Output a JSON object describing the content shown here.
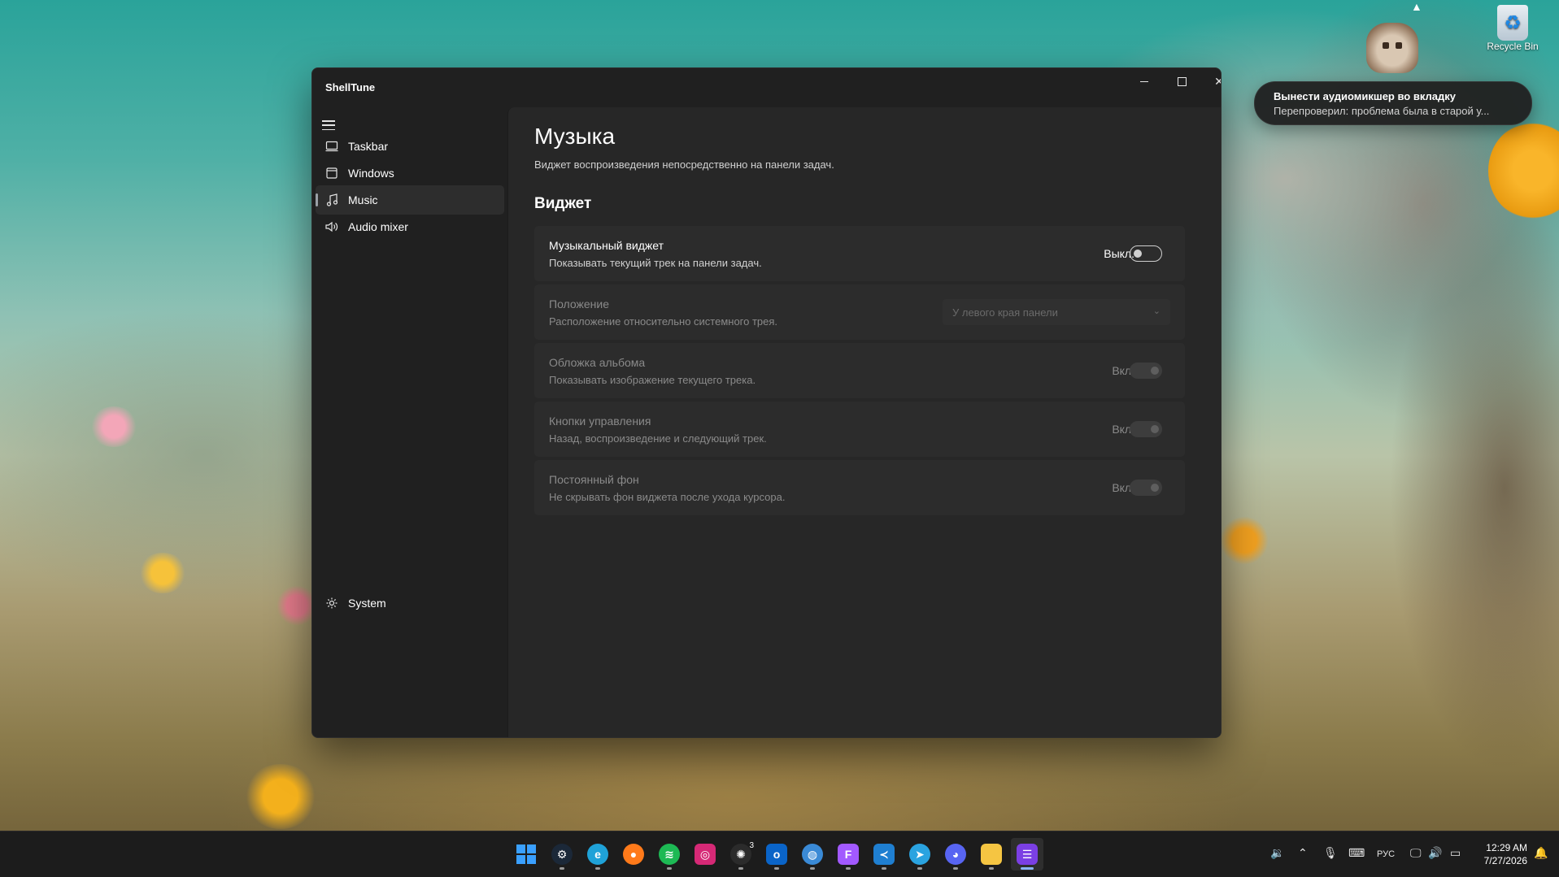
{
  "desktop": {
    "recycle_bin_label": "Recycle Bin"
  },
  "notification": {
    "title": "Вынести аудиомикшер во вкладку",
    "body": "Перепроверил: проблема была в старой у..."
  },
  "window": {
    "title": "ShellTune",
    "controls": {
      "minimize": "minimize-icon",
      "maximize": "maximize-icon",
      "close": "close-icon"
    }
  },
  "sidebar": {
    "items": [
      {
        "label": "Taskbar",
        "icon": "taskbar-icon",
        "active": false
      },
      {
        "label": "Windows",
        "icon": "window-icon",
        "active": false
      },
      {
        "label": "Music",
        "icon": "music-note-icon",
        "active": true
      },
      {
        "label": "Audio mixer",
        "icon": "speaker-icon",
        "active": false
      }
    ],
    "footer": {
      "label": "System",
      "icon": "gear-icon"
    }
  },
  "page": {
    "title": "Музыка",
    "subtitle": "Виджет воспроизведения непосредственно на панели задач.",
    "section": "Виджет"
  },
  "settings": [
    {
      "title": "Музыкальный виджет",
      "desc": "Показывать текущий трек на панели задач.",
      "state_label": "Выкл.",
      "enabled": true,
      "on": false
    },
    {
      "title": "Положение",
      "desc": "Расположение относительно системного трея.",
      "dropdown_value": "У левого края панели",
      "enabled": false
    },
    {
      "title": "Обложка альбома",
      "desc": "Показывать изображение текущего трека.",
      "state_label": "Вкл.",
      "enabled": false,
      "on": true
    },
    {
      "title": "Кнопки управления",
      "desc": "Назад, воспроизведение и следующий трек.",
      "state_label": "Вкл.",
      "enabled": false,
      "on": true
    },
    {
      "title": "Постоянный фон",
      "desc": "Не скрывать фон виджета после ухода курсора.",
      "state_label": "Вкл.",
      "enabled": false,
      "on": true
    }
  ],
  "taskbar": {
    "apps": [
      {
        "name": "start",
        "icon": "windows-logo-icon",
        "color": "#3aa0ff"
      },
      {
        "name": "steam",
        "icon": "steam-icon",
        "color": "#1b2838"
      },
      {
        "name": "edge",
        "icon": "edge-icon",
        "color": "#1fa2d8"
      },
      {
        "name": "firefox",
        "icon": "firefox-icon",
        "color": "#ff7a1a"
      },
      {
        "name": "spotify",
        "icon": "spotify-icon",
        "color": "#1db954"
      },
      {
        "name": "instagram",
        "icon": "instagram-icon",
        "color": "#d62976"
      },
      {
        "name": "chatgpt",
        "icon": "chatgpt-icon",
        "color": "#2b2b2b",
        "badge": "3"
      },
      {
        "name": "outlook",
        "icon": "outlook-icon",
        "color": "#0a64c8"
      },
      {
        "name": "browser",
        "icon": "globe-icon",
        "color": "#3a8ad6"
      },
      {
        "name": "figma",
        "icon": "figma-icon",
        "color": "#a259ff"
      },
      {
        "name": "vscode",
        "icon": "vscode-icon",
        "color": "#1f7fd1"
      },
      {
        "name": "telegram",
        "icon": "telegram-icon",
        "color": "#2aa3e0"
      },
      {
        "name": "discord",
        "icon": "discord-icon",
        "color": "#5865f2"
      },
      {
        "name": "explorer",
        "icon": "folder-icon",
        "color": "#f5c542"
      },
      {
        "name": "shelltune",
        "icon": "shelltune-icon",
        "color": "#7b3fe4",
        "active": true
      }
    ],
    "tray": {
      "language": "РУС",
      "time": "12:29 AM",
      "date": "7/27/2026"
    }
  }
}
